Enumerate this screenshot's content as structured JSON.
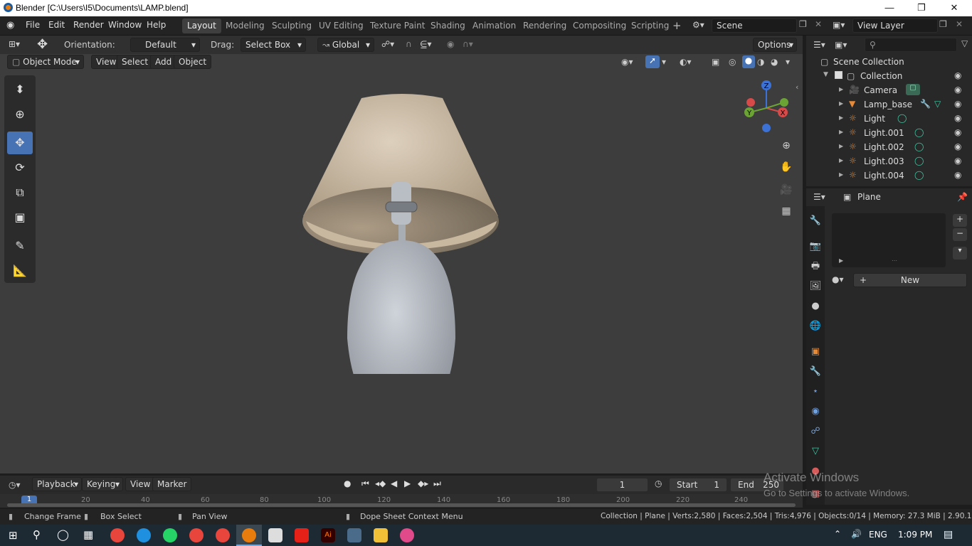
{
  "window": {
    "title": "Blender [C:\\Users\\I5\\Documents\\LAMP.blend]"
  },
  "menu": [
    "File",
    "Edit",
    "Render",
    "Window",
    "Help"
  ],
  "workspaces": [
    "Layout",
    "Modeling",
    "Sculpting",
    "UV Editing",
    "Texture Paint",
    "Shading",
    "Animation",
    "Rendering",
    "Compositing",
    "Scripting"
  ],
  "active_workspace": "Layout",
  "scene": {
    "name": "Scene",
    "view_layer": "View Layer"
  },
  "header": {
    "orientation_label": "Orientation:",
    "orientation_value": "Default",
    "drag_label": "Drag:",
    "drag_value": "Select Box",
    "transform_space": "Global",
    "options": "Options"
  },
  "viewport_header": {
    "mode": "Object Mode",
    "menus": [
      "View",
      "Select",
      "Add",
      "Object"
    ]
  },
  "gizmo": {
    "z": "Z",
    "y": "Y",
    "x": "X"
  },
  "outliner": {
    "root": "Scene Collection",
    "collection": "Collection",
    "items": [
      "Camera",
      "Lamp_base",
      "Light",
      "Light.001",
      "Light.002",
      "Light.003",
      "Light.004"
    ]
  },
  "properties": {
    "object_name": "Plane",
    "new_button": "New"
  },
  "timeline": {
    "menus": [
      "Playback",
      "Keying",
      "View",
      "Marker"
    ],
    "current_frame": "1",
    "start_label": "Start",
    "start_value": "1",
    "end_label": "End",
    "end_value": "250",
    "ruler_marks": [
      "20",
      "40",
      "60",
      "80",
      "100",
      "120",
      "140",
      "160",
      "180",
      "200",
      "220",
      "240"
    ],
    "ruler_current": "1"
  },
  "watermark": {
    "line1": "Activate Windows",
    "line2": "Go to Settings to activate Windows."
  },
  "status": {
    "hint1": "Change Frame",
    "hint2": "Box Select",
    "hint3": "Pan View",
    "hint4": "Dope Sheet Context Menu",
    "stats": "Collection | Plane | Verts:2,580 | Faces:2,504 | Tris:4,976 | Objects:0/14 | Memory: 27.3 MiB | 2.90.1"
  },
  "taskbar": {
    "lang": "ENG",
    "time": "1:09 PM"
  },
  "colors": {
    "accent": "#4772b3",
    "shade": "#c9b8a0",
    "base": "#b8bcc4",
    "viewport": "#3d3d3d"
  }
}
